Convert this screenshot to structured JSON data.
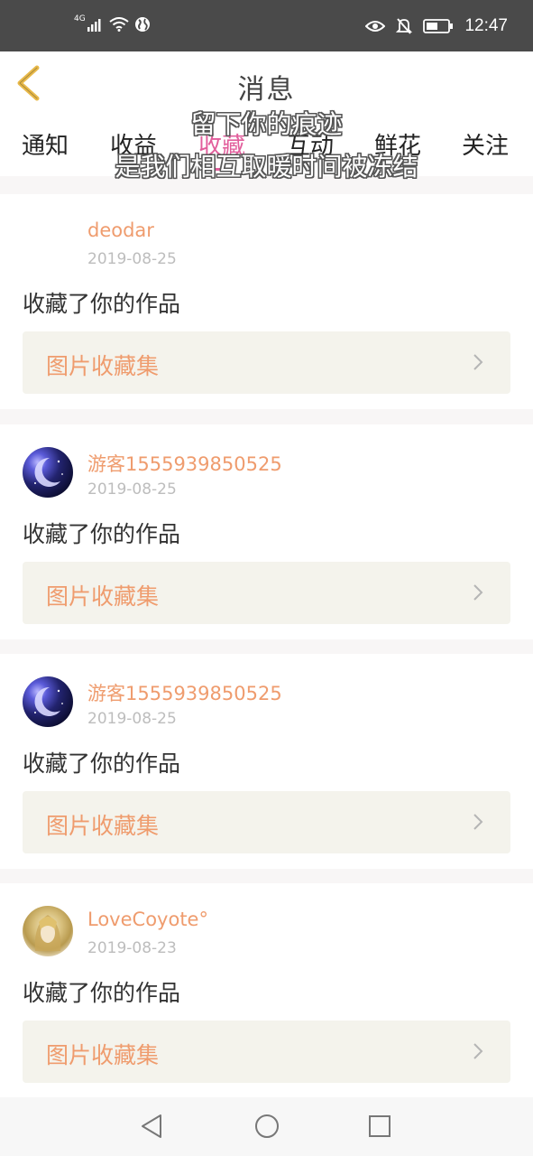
{
  "status_bar": {
    "network": "4G",
    "time": "12:47"
  },
  "header": {
    "title": "消息"
  },
  "tabs": [
    {
      "label": "通知",
      "active": false
    },
    {
      "label": "收益",
      "active": false
    },
    {
      "label": "收藏",
      "active": true
    },
    {
      "label": "互动",
      "active": false
    },
    {
      "label": "鲜花",
      "active": false
    },
    {
      "label": "关注",
      "active": false
    }
  ],
  "overlay": {
    "line1": "留下你的痕迹",
    "line2": "是我们相互取暖时间被冻结"
  },
  "feed": [
    {
      "username": "deodar",
      "date": "2019-08-25",
      "action": "收藏了你的作品",
      "collection": "图片收藏集"
    },
    {
      "username": "游客1555939850525",
      "date": "2019-08-25",
      "action": "收藏了你的作品",
      "collection": "图片收藏集"
    },
    {
      "username": "游客1555939850525",
      "date": "2019-08-25",
      "action": "收藏了你的作品",
      "collection": "图片收藏集"
    },
    {
      "username": "LoveCoyote°",
      "date": "2019-08-23",
      "action": "收藏了你的作品",
      "collection": "图片收藏集"
    }
  ],
  "colors": {
    "accent": "#e25e9c",
    "username": "#ef9c6e",
    "back_arrow": "#e8b94a"
  },
  "icons": {
    "back": "back-arrow-icon",
    "chevron": "chevron-right-icon",
    "nav_back": "nav-back-icon",
    "nav_home": "nav-home-icon",
    "nav_recents": "nav-recents-icon"
  }
}
